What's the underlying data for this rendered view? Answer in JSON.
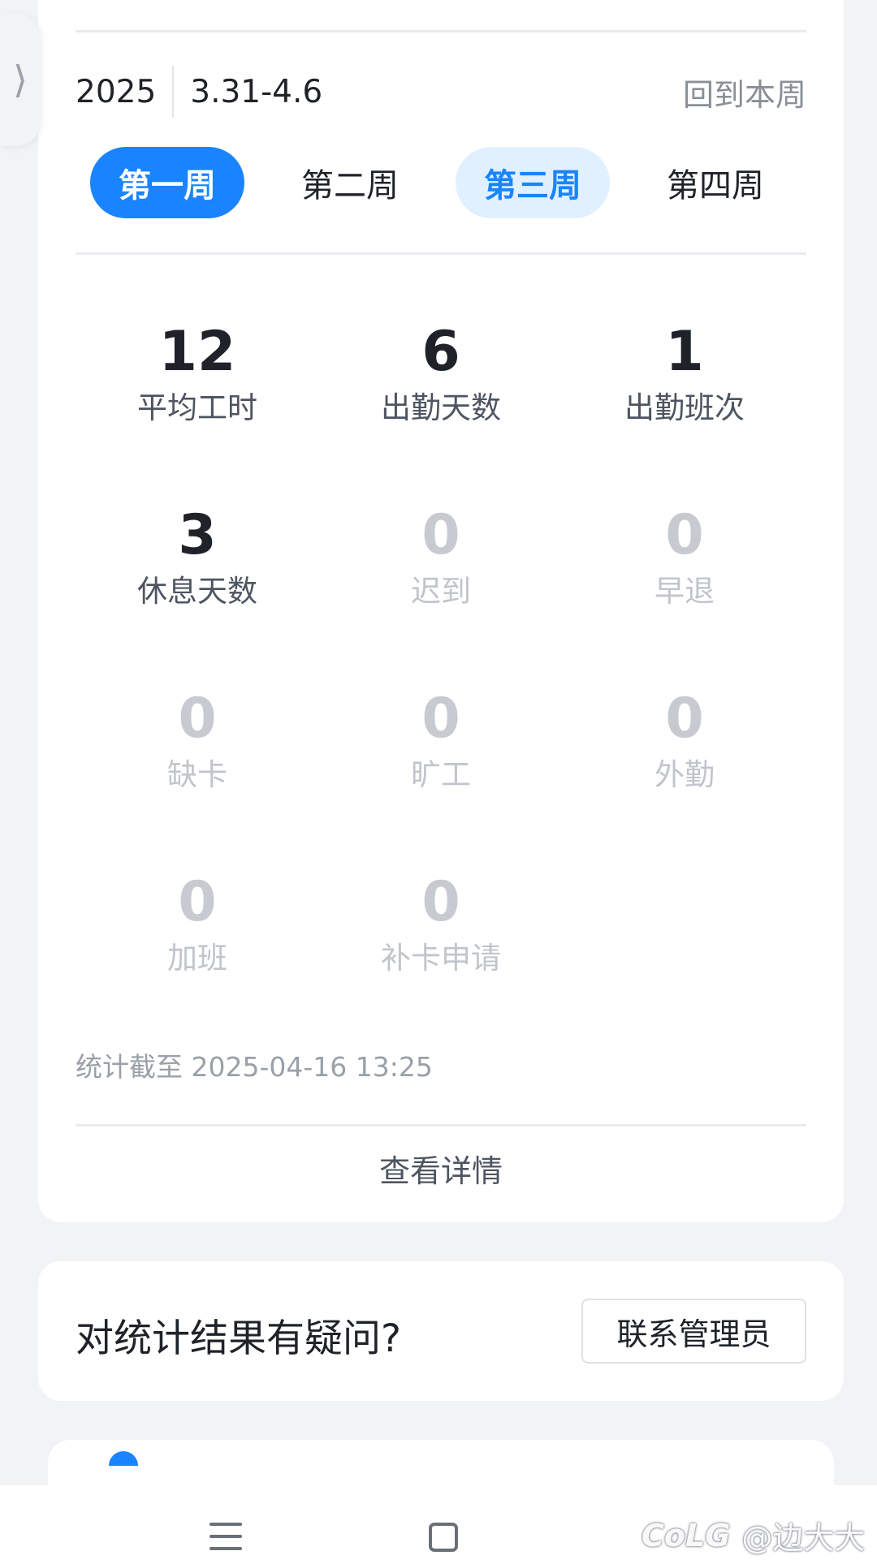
{
  "week_header": {
    "year": "2025",
    "range": "3.31-4.6",
    "back_to_current": "回到本周"
  },
  "week_tabs": [
    {
      "label": "第一周",
      "state": "selected"
    },
    {
      "label": "第二周",
      "state": "normal"
    },
    {
      "label": "第三周",
      "state": "current"
    },
    {
      "label": "第四周",
      "state": "normal"
    }
  ],
  "stats": [
    {
      "value": "12",
      "label": "平均工时"
    },
    {
      "value": "6",
      "label": "出勤天数"
    },
    {
      "value": "1",
      "label": "出勤班次"
    },
    {
      "value": "3",
      "label": "休息天数"
    },
    {
      "value": "0",
      "label": "迟到"
    },
    {
      "value": "0",
      "label": "早退"
    },
    {
      "value": "0",
      "label": "缺卡"
    },
    {
      "value": "0",
      "label": "旷工"
    },
    {
      "value": "0",
      "label": "外勤"
    },
    {
      "value": "0",
      "label": "加班"
    },
    {
      "value": "0",
      "label": "补卡申请"
    }
  ],
  "updated_text": "统计截至 2025-04-16 13:25",
  "view_detail": "查看详情",
  "question": {
    "text": "对统计结果有疑问?",
    "button": "联系管理员"
  },
  "watermark": {
    "logo": "CoLG",
    "handle": "@边大大"
  },
  "icons": {
    "side_tab": "chevron-right-icon",
    "nav_menu": "menu-icon",
    "nav_home": "home-square-icon"
  },
  "colors": {
    "accent": "#1a84ff",
    "accent_light": "#e1f0ff",
    "background": "#f2f3f5",
    "text_primary": "#1f2329",
    "text_dim": "#c7cbd1"
  }
}
